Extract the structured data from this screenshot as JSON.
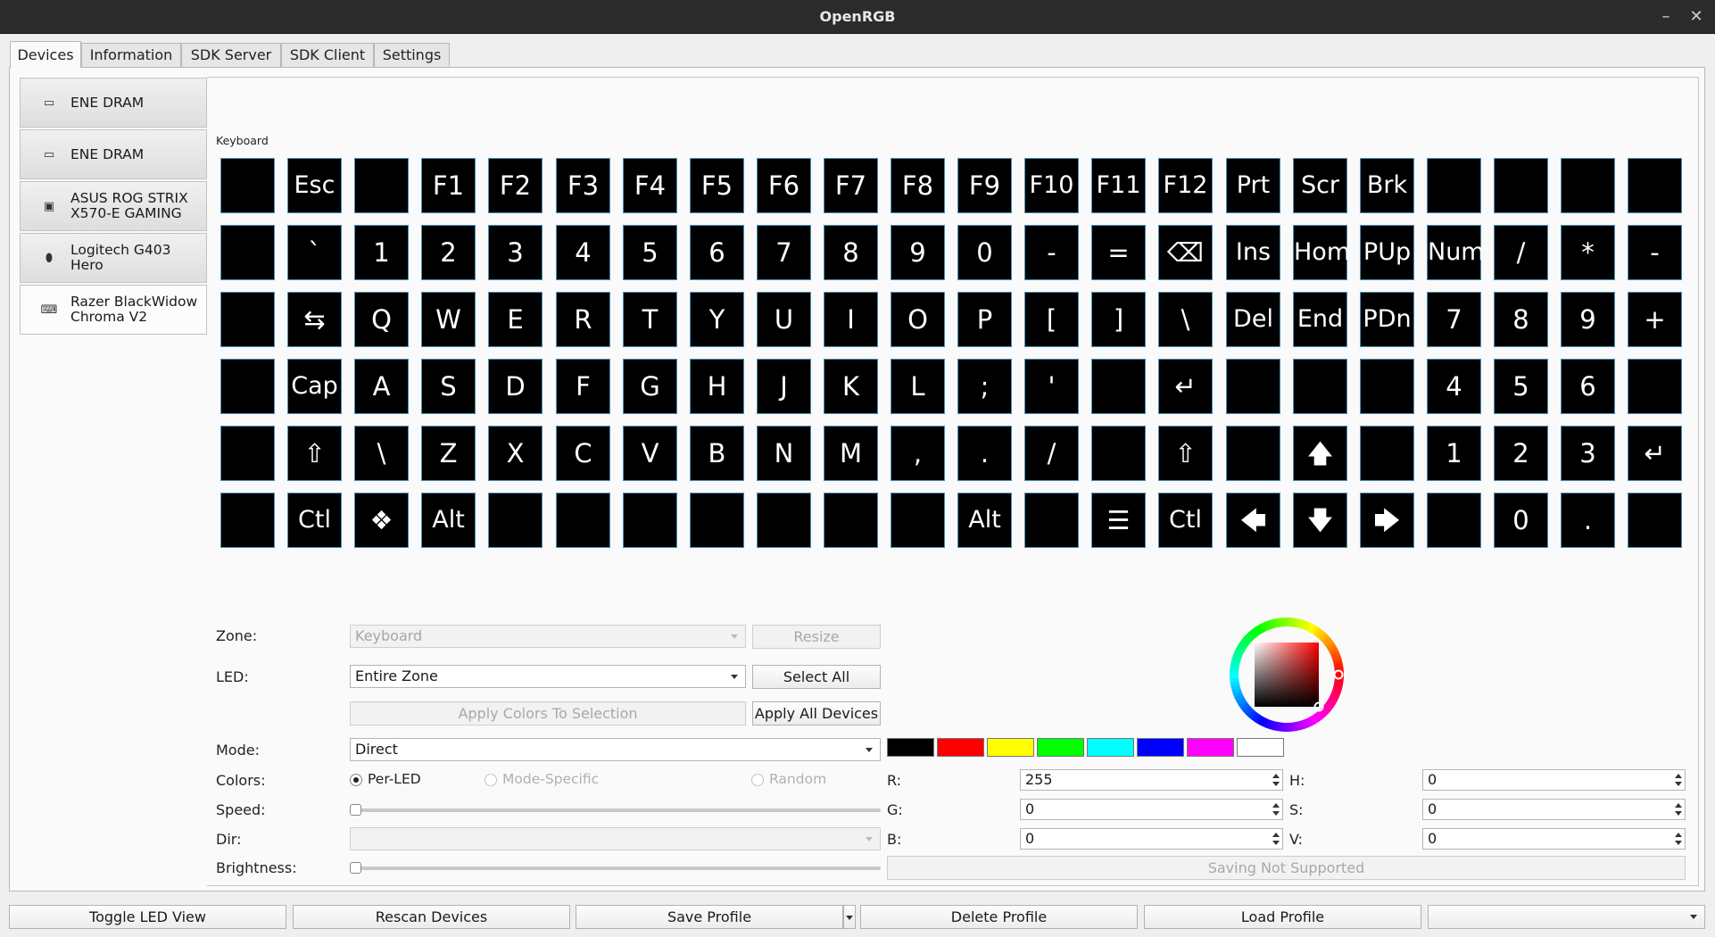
{
  "window": {
    "title": "OpenRGB",
    "minimize_glyph": "–",
    "close_glyph": "✕"
  },
  "tabs": [
    {
      "label": "Devices",
      "active": true
    },
    {
      "label": "Information",
      "active": false
    },
    {
      "label": "SDK Server",
      "active": false
    },
    {
      "label": "SDK Client",
      "active": false
    },
    {
      "label": "Settings",
      "active": false
    }
  ],
  "devices": [
    {
      "label": "ENE DRAM",
      "icon": "ram-icon",
      "glyph": "▭",
      "selected": false
    },
    {
      "label": "ENE DRAM",
      "icon": "ram-icon",
      "glyph": "▭",
      "selected": false
    },
    {
      "label": "ASUS ROG STRIX\nX570-E GAMING",
      "icon": "motherboard-icon",
      "glyph": "▣",
      "selected": false
    },
    {
      "label": "Logitech G403\nHero",
      "icon": "mouse-icon",
      "glyph": "⬮",
      "selected": false
    },
    {
      "label": "Razer BlackWidow\nChroma V2",
      "icon": "keyboard-icon",
      "glyph": "⌨",
      "selected": true
    }
  ],
  "keyboard": {
    "title": "Keyboard",
    "rows": [
      [
        "",
        "Esc",
        "",
        "F1",
        "F2",
        "F3",
        "F4",
        "F5",
        "F6",
        "F7",
        "F8",
        "F9",
        "F10",
        "F11",
        "F12",
        "Prt",
        "Scr",
        "Brk",
        "",
        "",
        "",
        ""
      ],
      [
        "",
        "`",
        "1",
        "2",
        "3",
        "4",
        "5",
        "6",
        "7",
        "8",
        "9",
        "0",
        "-",
        "=",
        "⌫",
        "Ins",
        "Hom",
        "PUp",
        "Num",
        "/",
        "*",
        "-"
      ],
      [
        "",
        "⇆",
        "Q",
        "W",
        "E",
        "R",
        "T",
        "Y",
        "U",
        "I",
        "O",
        "P",
        "[",
        "]",
        "\\",
        "Del",
        "End",
        "PDn",
        "7",
        "8",
        "9",
        "+"
      ],
      [
        "",
        "Cap",
        "A",
        "S",
        "D",
        "F",
        "G",
        "H",
        "J",
        "K",
        "L",
        ";",
        "'",
        "",
        "↵",
        "",
        "",
        "",
        "4",
        "5",
        "6",
        ""
      ],
      [
        "",
        "⇧",
        "\\",
        "Z",
        "X",
        "C",
        "V",
        "B",
        "N",
        "M",
        ",",
        ".",
        "/",
        "",
        "⇧",
        "",
        "🡅",
        "",
        "1",
        "2",
        "3",
        "↵"
      ],
      [
        "",
        "Ctl",
        "❖",
        "Alt",
        "",
        "",
        "",
        "",
        "",
        "",
        "",
        "Alt",
        "",
        "☰",
        "Ctl",
        "🡄",
        "🡇",
        "🡆",
        "",
        "0",
        ".",
        ""
      ]
    ]
  },
  "controls": {
    "zone_label": "Zone:",
    "zone_value": "Keyboard",
    "resize_label": "Resize",
    "led_label": "LED:",
    "led_value": "Entire Zone",
    "select_all_label": "Select All",
    "apply_selection_label": "Apply Colors To Selection",
    "apply_all_label": "Apply All Devices",
    "mode_label": "Mode:",
    "mode_value": "Direct",
    "colors_label": "Colors:",
    "color_modes": [
      {
        "label": "Per-LED",
        "checked": true,
        "enabled": true
      },
      {
        "label": "Mode-Specific",
        "checked": false,
        "enabled": false
      },
      {
        "label": "Random",
        "checked": false,
        "enabled": false
      }
    ],
    "speed_label": "Speed:",
    "dir_label": "Dir:",
    "dir_value": "",
    "brightness_label": "Brightness:",
    "saving_label": "Saving Not Supported"
  },
  "color": {
    "swatches": [
      "#000000",
      "#ff0000",
      "#ffff00",
      "#00ff00",
      "#00ffff",
      "#0000ff",
      "#ff00ff",
      "#ffffff"
    ],
    "r_label": "R:",
    "r": "255",
    "g_label": "G:",
    "g": "0",
    "b_label": "B:",
    "b": "0",
    "h_label": "H:",
    "h": "0",
    "s_label": "S:",
    "s": "0",
    "v_label": "V:",
    "v": "0",
    "picker_hue_color": "#ff0000"
  },
  "bottom_bar": {
    "toggle_led_view": "Toggle LED View",
    "rescan_devices": "Rescan Devices",
    "save_profile": "Save Profile",
    "delete_profile": "Delete Profile",
    "load_profile": "Load Profile",
    "profile_value": ""
  }
}
